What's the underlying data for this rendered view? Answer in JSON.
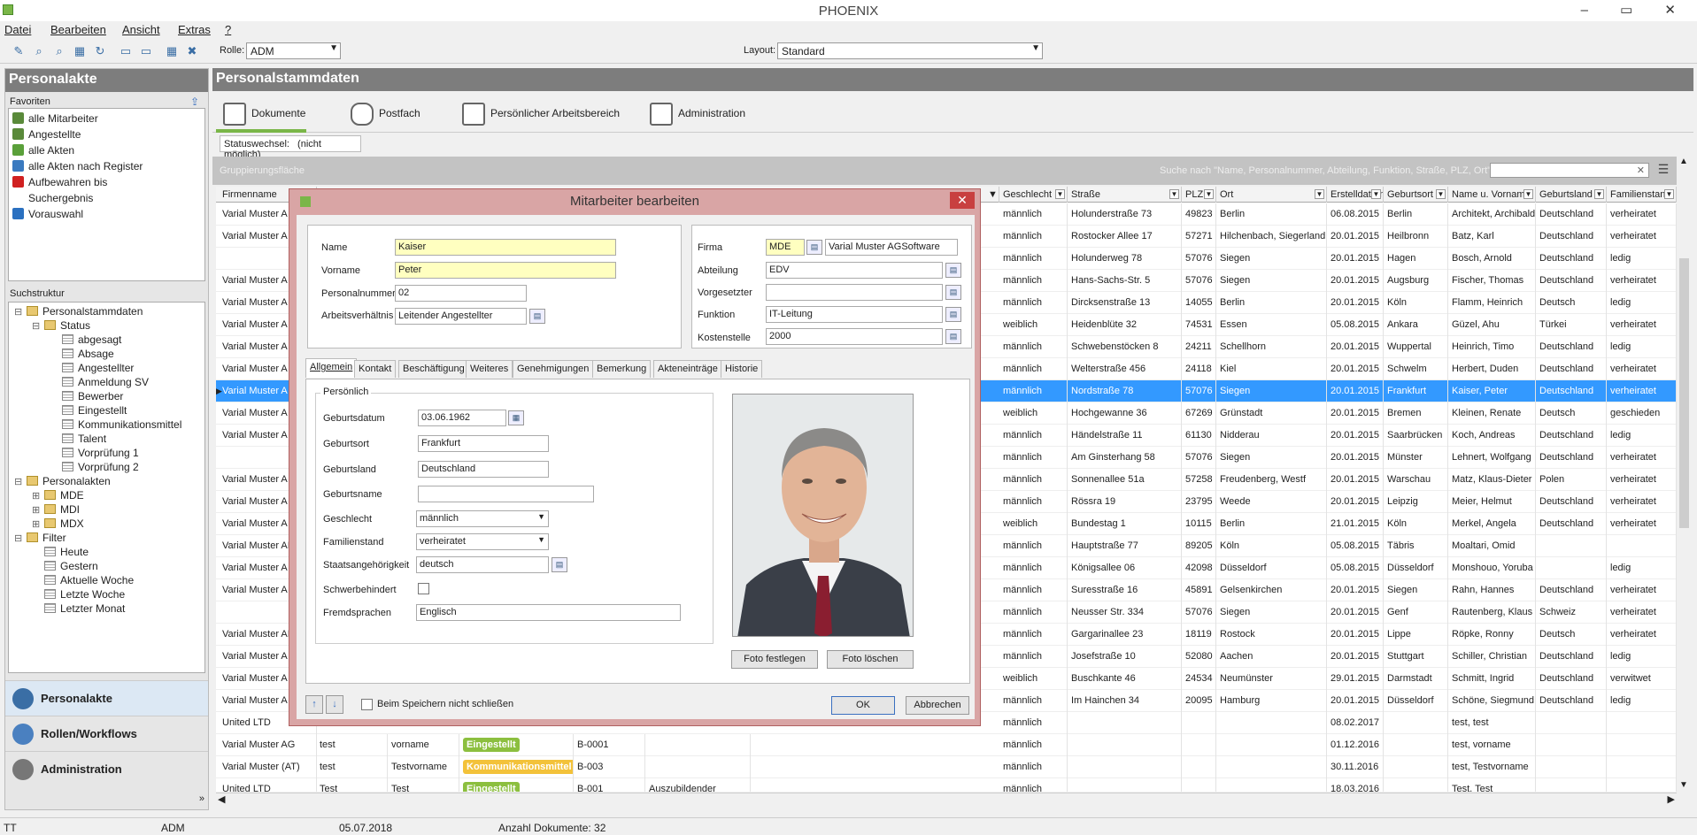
{
  "app": {
    "title": "PHOENIX",
    "win_controls": "– ▭ ✕"
  },
  "menu": {
    "items": [
      "Datei",
      "Bearbeiten",
      "Ansicht",
      "Extras",
      "?"
    ]
  },
  "toolbar": {
    "rolle_label": "Rolle:",
    "rolle_value": "ADM",
    "layout_label": "Layout:",
    "layout_value": "Standard"
  },
  "left": {
    "title": "Personalakte",
    "fav_title": "Favoriten",
    "favorites": [
      {
        "label": "alle Mitarbeiter",
        "color": "#5a8a3a"
      },
      {
        "label": "Angestellte",
        "color": "#5a8a3a"
      },
      {
        "label": "alle Akten",
        "color": "#5aa03a"
      },
      {
        "label": "alle Akten nach Register",
        "color": "#3a7ac0"
      },
      {
        "label": "Aufbewahren bis",
        "color": "#d02020"
      },
      {
        "label": "Suchergebnis",
        "color": "#ffffff"
      },
      {
        "label": "Vorauswahl",
        "color": "#2a70c0"
      }
    ],
    "tree_title": "Suchstruktur",
    "tree": [
      {
        "label": "Personalstammdaten",
        "indent": 0,
        "exp": "⊟"
      },
      {
        "label": "Status",
        "indent": 1,
        "exp": "⊟"
      },
      {
        "label": "abgesagt",
        "indent": 2,
        "exp": ""
      },
      {
        "label": "Absage",
        "indent": 2,
        "exp": ""
      },
      {
        "label": "Angestellter",
        "indent": 2,
        "exp": ""
      },
      {
        "label": "Anmeldung SV",
        "indent": 2,
        "exp": ""
      },
      {
        "label": "Bewerber",
        "indent": 2,
        "exp": ""
      },
      {
        "label": "Eingestellt",
        "indent": 2,
        "exp": ""
      },
      {
        "label": "Kommunikationsmittel",
        "indent": 2,
        "exp": ""
      },
      {
        "label": "Talent",
        "indent": 2,
        "exp": ""
      },
      {
        "label": "Vorprüfung 1",
        "indent": 2,
        "exp": ""
      },
      {
        "label": "Vorprüfung 2",
        "indent": 2,
        "exp": ""
      },
      {
        "label": "Personalakten",
        "indent": 0,
        "exp": "⊟"
      },
      {
        "label": "MDE",
        "indent": 1,
        "exp": "⊞"
      },
      {
        "label": "MDI",
        "indent": 1,
        "exp": "⊞"
      },
      {
        "label": "MDX",
        "indent": 1,
        "exp": "⊞"
      },
      {
        "label": "Filter",
        "indent": 0,
        "exp": "⊟"
      },
      {
        "label": "Heute",
        "indent": 1,
        "exp": ""
      },
      {
        "label": "Gestern",
        "indent": 1,
        "exp": ""
      },
      {
        "label": "Aktuelle Woche",
        "indent": 1,
        "exp": ""
      },
      {
        "label": "Letzte Woche",
        "indent": 1,
        "exp": ""
      },
      {
        "label": "Letzter Monat",
        "indent": 1,
        "exp": ""
      }
    ],
    "nav": [
      {
        "label": "Personalakte",
        "color": "#3a6ea5"
      },
      {
        "label": "Rollen/Workflows",
        "color": "#4a80c0"
      },
      {
        "label": "Administration",
        "color": "#777777"
      }
    ]
  },
  "main": {
    "title": "Personalstammdaten",
    "tabs": [
      "Dokumente",
      "Postfach",
      "Persönlicher Arbeitsbereich",
      "Administration"
    ],
    "status_label": "Statuswechsel:",
    "status_value": "(nicht möglich)",
    "group_area": "Gruppierungsfläche",
    "search_hint": "Suche nach \"Name, Personalnummer, Abteilung, Funktion, Straße, PLZ, Ort\"",
    "columns": [
      "Firmenname",
      "Geschlecht",
      "Straße",
      "PLZ",
      "Ort",
      "Erstelldatum",
      "Geburtsort",
      "Name u. Vorname",
      "Geburtsland",
      "Familienstand"
    ],
    "rows": [
      [
        "Varial Muster A",
        "männlich",
        "Holunderstraße 73",
        "49823",
        "Berlin",
        "06.08.2015",
        "Berlin",
        "Architekt, Archibald",
        "Deutschland",
        "verheiratet"
      ],
      [
        "Varial Muster A",
        "männlich",
        "Rostocker Allee 17",
        "57271",
        "Hilchenbach, Siegerland",
        "20.01.2015",
        "Heilbronn",
        "Batz, Karl",
        "Deutschland",
        "verheiratet"
      ],
      [
        "",
        "männlich",
        "Holunderweg 78",
        "57076",
        "Siegen",
        "20.01.2015",
        "Hagen",
        "Bosch, Arnold",
        "Deutschland",
        "ledig"
      ],
      [
        "Varial Muster A",
        "männlich",
        "Hans-Sachs-Str. 5",
        "57076",
        "Siegen",
        "20.01.2015",
        "Augsburg",
        "Fischer, Thomas",
        "Deutschland",
        "verheiratet"
      ],
      [
        "Varial Muster A",
        "männlich",
        "Dircksenstraße 13",
        "14055",
        "Berlin",
        "20.01.2015",
        "Köln",
        "Flamm, Heinrich",
        "Deutsch",
        "ledig"
      ],
      [
        "Varial Muster A",
        "weiblich",
        "Heidenblüte 32",
        "74531",
        "Essen",
        "05.08.2015",
        "Ankara",
        "Güzel, Ahu",
        "Türkei",
        "verheiratet"
      ],
      [
        "Varial Muster A",
        "männlich",
        "Schwebenstöcken 8",
        "24211",
        "Schellhorn",
        "20.01.2015",
        "Wuppertal",
        "Heinrich, Timo",
        "Deutschland",
        "ledig"
      ],
      [
        "Varial Muster A",
        "männlich",
        "Welterstraße 456",
        "24118",
        "Kiel",
        "20.01.2015",
        "Schwelm",
        "Herbert, Duden",
        "Deutschland",
        "verheiratet"
      ],
      [
        "Varial Muster A",
        "männlich",
        "Nordstraße 78",
        "57076",
        "Siegen",
        "20.01.2015",
        "Frankfurt",
        "Kaiser, Peter",
        "Deutschland",
        "verheiratet"
      ],
      [
        "Varial Muster A",
        "weiblich",
        "Hochgewanne 36",
        "67269",
        "Grünstadt",
        "20.01.2015",
        "Bremen",
        "Kleinen, Renate",
        "Deutsch",
        "geschieden"
      ],
      [
        "Varial Muster A",
        "männlich",
        "Händelstraße 11",
        "61130",
        "Nidderau",
        "20.01.2015",
        "Saarbrücken",
        "Koch, Andreas",
        "Deutschland",
        "ledig"
      ],
      [
        "",
        "männlich",
        "Am Ginsterhang 58",
        "57076",
        "Siegen",
        "20.01.2015",
        "Münster",
        "Lehnert, Wolfgang",
        "Deutschland",
        "verheiratet"
      ],
      [
        "Varial Muster A",
        "männlich",
        "Sonnenallee 51a",
        "57258",
        "Freudenberg, Westf",
        "20.01.2015",
        "Warschau",
        "Matz, Klaus-Dieter",
        "Polen",
        "verheiratet"
      ],
      [
        "Varial Muster A",
        "männlich",
        "Rössra 19",
        "23795",
        "Weede",
        "20.01.2015",
        "Leipzig",
        "Meier, Helmut",
        "Deutschland",
        "verheiratet"
      ],
      [
        "Varial Muster A",
        "weiblich",
        "Bundestag 1",
        "10115",
        "Berlin",
        "21.01.2015",
        "Köln",
        "Merkel, Angela",
        "Deutschland",
        "verheiratet"
      ],
      [
        "Varial Muster AI",
        "männlich",
        "Hauptstraße 77",
        "89205",
        "Köln",
        "05.08.2015",
        "Täbris",
        "Moaltari, Omid",
        "",
        ""
      ],
      [
        "Varial Muster A",
        "männlich",
        "Königsallee 06",
        "42098",
        "Düsseldorf",
        "05.08.2015",
        "Düsseldorf",
        "Monshouo, Yoruba",
        "",
        "ledig"
      ],
      [
        "Varial Muster A",
        "männlich",
        "Suresstraße 16",
        "45891",
        "Gelsenkirchen",
        "20.01.2015",
        "Siegen",
        "Rahn, Hannes",
        "Deutschland",
        "verheiratet"
      ],
      [
        "",
        "männlich",
        "Neusser Str. 334",
        "57076",
        "Siegen",
        "20.01.2015",
        "Genf",
        "Rautenberg, Klaus",
        "Schweiz",
        "verheiratet"
      ],
      [
        "Varial Muster AI",
        "männlich",
        "Gargarinallee 23",
        "18119",
        "Rostock",
        "20.01.2015",
        "Lippe",
        "Röpke, Ronny",
        "Deutsch",
        "verheiratet"
      ],
      [
        "Varial Muster A",
        "männlich",
        "Josefstraße 10",
        "52080",
        "Aachen",
        "20.01.2015",
        "Stuttgart",
        "Schiller, Christian",
        "Deutschland",
        "ledig"
      ],
      [
        "Varial Muster A",
        "weiblich",
        "Buschkante 46",
        "24534",
        "Neumünster",
        "29.01.2015",
        "Darmstadt",
        "Schmitt, Ingrid",
        "Deutschland",
        "verwitwet"
      ],
      [
        "Varial Muster A",
        "männlich",
        "Im Hainchen 34",
        "20095",
        "Hamburg",
        "20.01.2015",
        "Düsseldorf",
        "Schöne, Siegmund",
        "Deutschland",
        "ledig"
      ],
      [
        "United LTD",
        "männlich",
        "",
        "",
        "",
        "08.02.2017",
        "",
        "test, test",
        "",
        ""
      ],
      [
        "Varial Muster AG",
        "männlich",
        "",
        "",
        "",
        "01.12.2016",
        "",
        "test, vorname",
        "",
        ""
      ],
      [
        "Varial Muster (AT)",
        "männlich",
        "",
        "",
        "",
        "30.11.2016",
        "",
        "test, Testvorname",
        "",
        ""
      ],
      [
        "United LTD",
        "männlich",
        "",
        "",
        "",
        "18.03.2016",
        "",
        "Test, Test",
        "",
        ""
      ]
    ],
    "extra_rows": [
      {
        "row": 24,
        "name": "test",
        "vorname": "vorname",
        "status": "Eingestellt",
        "status_color": "#8cbf3f",
        "nr": "B-0001",
        "extra": ""
      },
      {
        "row": 25,
        "name": "test",
        "vorname": "Testvorname",
        "status": "Kommunikationsmittel",
        "status_color": "#f3c23a",
        "nr": "B-003",
        "extra": ""
      },
      {
        "row": 26,
        "name": "Test",
        "vorname": "Test",
        "status": "Eingestellt",
        "status_color": "#8cbf3f",
        "nr": "B-001",
        "extra": "Auszubildender"
      }
    ]
  },
  "dialog": {
    "title": "Mitarbeiter bearbeiten",
    "name_label": "Name",
    "name": "Kaiser",
    "vorname_label": "Vorname",
    "vorname": "Peter",
    "pnr_label": "Personalnummer",
    "pnr": "02",
    "av_label": "Arbeitsverhältnis",
    "av": "Leitender Angestellter",
    "firma_label": "Firma",
    "firma_code": "MDE",
    "firma_name": "Varial Muster AGSoftware",
    "abt_label": "Abteilung",
    "abt": "EDV",
    "vorg_label": "Vorgesetzter",
    "vorg": "",
    "funk_label": "Funktion",
    "funk": "IT-Leitung",
    "kst_label": "Kostenstelle",
    "kst": "2000",
    "tabs": [
      "Allgemein",
      "Kontakt",
      "Beschäftigung",
      "Weiteres",
      "Genehmigungen",
      "Bemerkung",
      "Akteneinträge",
      "Historie"
    ],
    "group": "Persönlich",
    "gebdat_label": "Geburtsdatum",
    "gebdat": "03.06.1962",
    "gebort_label": "Geburtsort",
    "gebort": "Frankfurt",
    "gebland_label": "Geburtsland",
    "gebland": "Deutschland",
    "gebname_label": "Geburtsname",
    "gebname": "",
    "geschl_label": "Geschlecht",
    "geschl": "männlich",
    "fam_label": "Familienstand",
    "fam": "verheiratet",
    "staat_label": "Staatsangehörigkeit",
    "staat": "deutsch",
    "schwer_label": "Schwerbehindert",
    "fremd_label": "Fremdsprachen",
    "fremd": "Englisch",
    "foto_set": "Foto festlegen",
    "foto_del": "Foto löschen",
    "noclose": "Beim Speichern nicht schließen",
    "ok": "OK",
    "cancel": "Abbrechen"
  },
  "statusbar": {
    "user": "TT",
    "role": "ADM",
    "date": "05.07.2018",
    "docs": "Anzahl Dokumente: 32"
  }
}
